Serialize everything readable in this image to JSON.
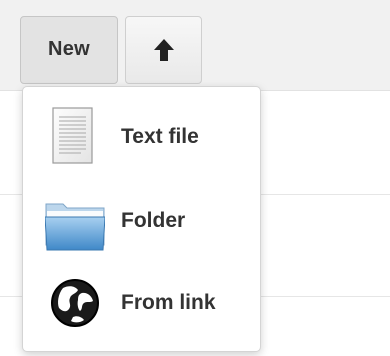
{
  "toolbar": {
    "new_label": "New",
    "upload_icon": "arrow-up-icon"
  },
  "new_menu": {
    "items": [
      {
        "label": "Text file",
        "icon": "text-file-icon"
      },
      {
        "label": "Folder",
        "icon": "folder-icon"
      },
      {
        "label": "From link",
        "icon": "globe-icon"
      }
    ]
  }
}
